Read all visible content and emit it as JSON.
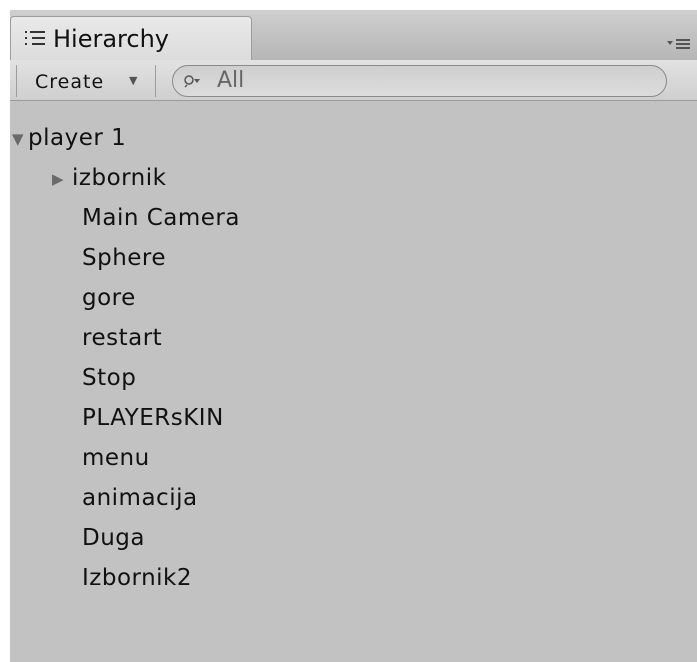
{
  "panel": {
    "tab_title": "Hierarchy",
    "tab_icon": "list-icon",
    "options_icon": "panel-options-icon"
  },
  "toolbar": {
    "create_label": "Create",
    "create_dropdown_icon": "dropdown-arrow-icon",
    "search_icon": "search-icon",
    "search_placeholder": "All"
  },
  "tree": {
    "root": {
      "label": "player 1",
      "expanded": true,
      "children": [
        {
          "label": "izbornik",
          "has_children": true,
          "expanded": false
        },
        {
          "label": "Main Camera"
        },
        {
          "label": "Sphere"
        },
        {
          "label": "gore"
        },
        {
          "label": "restart"
        },
        {
          "label": "Stop"
        },
        {
          "label": "PLAYERsKIN"
        },
        {
          "label": "menu"
        },
        {
          "label": "animacija"
        },
        {
          "label": "Duga"
        },
        {
          "label": "Izbornik2"
        }
      ]
    }
  }
}
